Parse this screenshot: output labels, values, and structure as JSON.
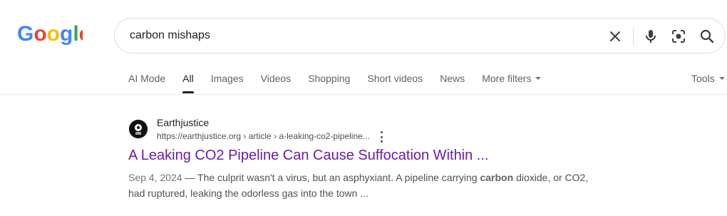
{
  "search": {
    "query": "carbon mishaps",
    "logo_text": "Google"
  },
  "tabs": [
    "AI Mode",
    "All",
    "Images",
    "Videos",
    "Shopping",
    "Short videos",
    "News",
    "More filters"
  ],
  "tools_label": "Tools",
  "result": {
    "site_name": "Earthjustice",
    "url": "https://earthjustice.org › article › a-leaking-co2-pipeline...",
    "title": "A Leaking CO2 Pipeline Can Cause Suffocation Within ...",
    "date": "Sep 4, 2024",
    "snippet_before": "The culprit wasn't a virus, but an asphyxiant. A pipeline carrying",
    "snippet_bold": "carbon",
    "snippet_after": "dioxide, or CO2, had ruptured, leaking the odorless gas into the town ..."
  },
  "icons": [
    "google-logo",
    "clear-icon",
    "microphone-icon",
    "camera-icon",
    "search-icon",
    "caret-down-icon",
    "favicon-icon",
    "more-vert-icon"
  ],
  "colors": {
    "title_link": "#681da8",
    "tab_active": "#202124",
    "tab_inactive": "#5f6368"
  }
}
